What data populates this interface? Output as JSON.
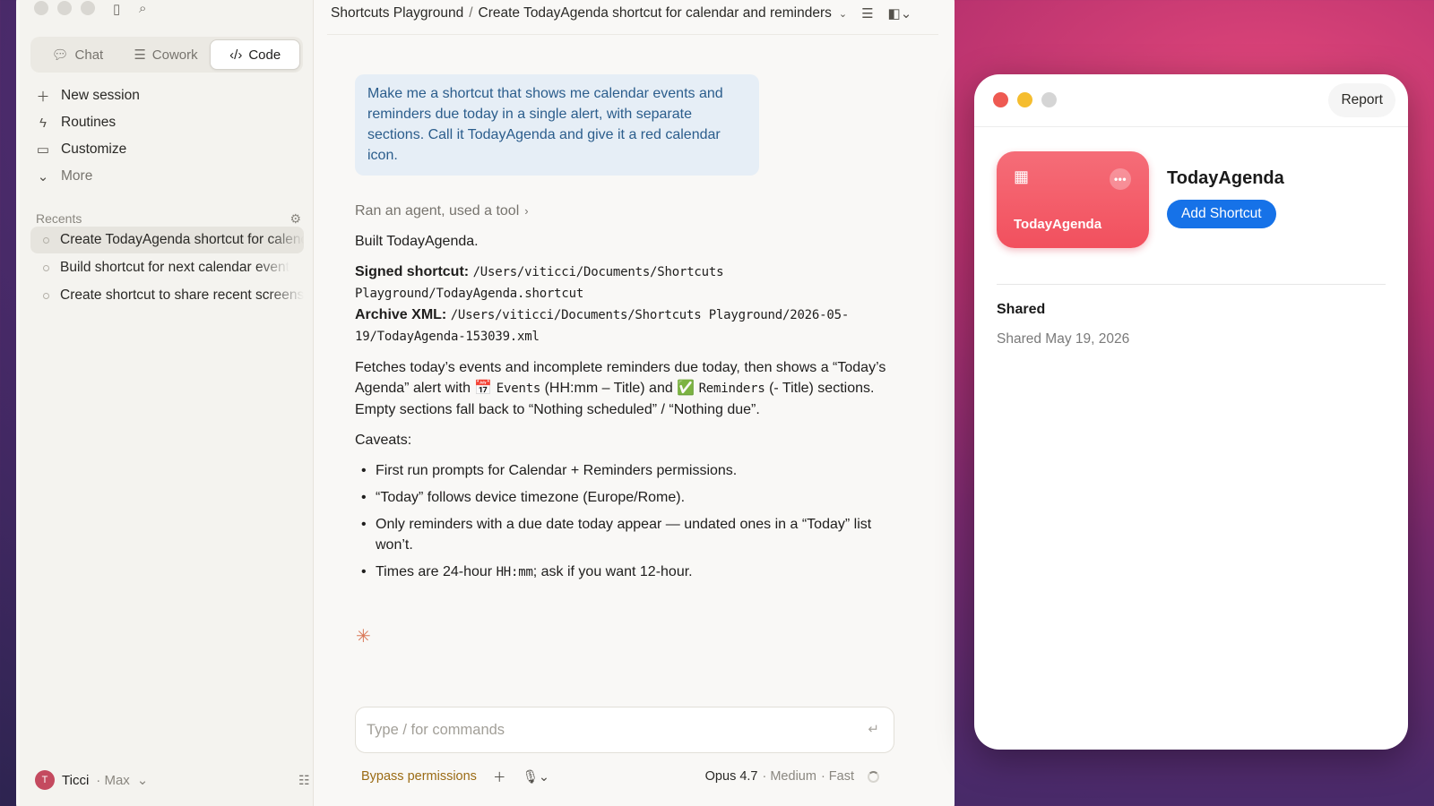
{
  "sidebar": {
    "modes": [
      {
        "label": "Chat",
        "icon": "chat-bubble-icon",
        "active": false
      },
      {
        "label": "Cowork",
        "icon": "checklist-icon",
        "active": false
      },
      {
        "label": "Code",
        "icon": "code-icon",
        "active": true
      }
    ],
    "nav": [
      {
        "label": "New session",
        "icon": "plus-icon"
      },
      {
        "label": "Routines",
        "icon": "lightning-icon"
      },
      {
        "label": "Customize",
        "icon": "briefcase-icon"
      },
      {
        "label": "More",
        "icon": "chevron-down-icon"
      }
    ],
    "recents_label": "Recents",
    "recents": [
      {
        "label": "Create TodayAgenda shortcut for calendar and reminders",
        "active": true
      },
      {
        "label": "Build shortcut for next calendar event",
        "active": false
      },
      {
        "label": "Create shortcut to share recent screenshots",
        "active": false
      }
    ],
    "user": {
      "initial": "T",
      "name": "Ticci",
      "plan": "· Max"
    }
  },
  "header": {
    "project": "Shortcuts Playground",
    "separator": "/",
    "title": "Create TodayAgenda shortcut for calendar and reminders"
  },
  "conversation": {
    "user_message": "Make me a shortcut that shows me calendar events and reminders due today in a single alert, with separate sections. Call it TodayAgenda and give it a red calendar icon.",
    "tool_summary": "Ran an agent, used a tool",
    "built": "Built TodayAgenda.",
    "signed_label": "Signed shortcut:",
    "signed_path": "/Users/viticci/Documents/Shortcuts Playground/TodayAgenda.shortcut",
    "archive_label": "Archive XML:",
    "archive_path": "/Users/viticci/Documents/Shortcuts Playground/2026-05-19/TodayAgenda-153039.xml",
    "desc_1": "Fetches today’s events and incomplete reminders due today, then shows a “Today’s Agenda” alert with ",
    "events_emoji": "📅",
    "events_code": "Events",
    "desc_2": " (HH:mm – Title) and ",
    "reminders_emoji": "✅",
    "reminders_code": "Reminders",
    "desc_3": " (- Title) sections. Empty sections fall back to “Nothing scheduled” / “Nothing due”.",
    "caveats_label": "Caveats:",
    "caveat_1": "First run prompts for Calendar + Reminders permissions.",
    "caveat_2": "“Today” follows device timezone (Europe/Rome).",
    "caveat_3": "Only reminders with a due date today appear — undated ones in a “Today” list won’t.",
    "caveat_4_a": "Times are 24-hour ",
    "caveat_4_code": "HH:mm",
    "caveat_4_b": "; ask if you want 12-hour."
  },
  "composer": {
    "placeholder": "Type / for commands",
    "permissions": "Bypass permissions",
    "model": "Opus 4.7",
    "effort": "· Medium",
    "speed": "· Fast"
  },
  "shortcut_window": {
    "report_label": "Report",
    "name": "TodayAgenda",
    "tile_label": "TodayAgenda",
    "add_label": "Add Shortcut",
    "shared_heading": "Shared",
    "shared_date": "Shared May 19, 2026",
    "tile_color": "#f2505e",
    "button_color": "#1672e8"
  }
}
